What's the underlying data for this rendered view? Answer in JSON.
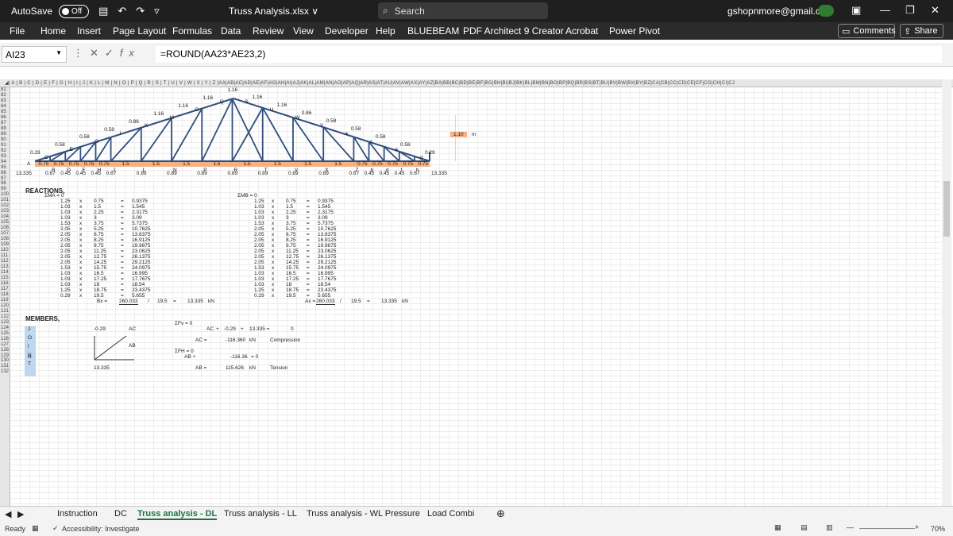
{
  "titlebar": {
    "autosave_label": "AutoSave",
    "autosave_state": "Off",
    "document_title": "Truss Analysis.xlsx ∨",
    "search_placeholder": "Search",
    "account_email": "gshopnmore@gmail.com"
  },
  "menu": {
    "file": "File",
    "home": "Home",
    "insert": "Insert",
    "page_layout": "Page Layout",
    "formulas": "Formulas",
    "data": "Data",
    "review": "Review",
    "view": "View",
    "developer": "Developer",
    "help": "Help",
    "bluebeam": "BLUEBEAM",
    "pdf_architect": "PDF Architect 9 Creator",
    "acrobat": "Acrobat",
    "power_pivot": "Power Pivot",
    "comments": "Comments",
    "share": "Share"
  },
  "formula_bar": {
    "name_box": "AI23",
    "fx": "fx",
    "formula": "=ROUND(AA23*AE23,2)"
  },
  "sheet": {
    "row_start": 81,
    "row_end": 132,
    "reactions_title": "REACTIONS,",
    "members_title": "MEMBERS,",
    "sum_ma": "ΣMA",
    "sum_mb": "ΣMB",
    "sum_fv": "ΣFv",
    "sum_fh": "ΣFH",
    "bx_label": "Bx =",
    "bx_value": "260.033",
    "ax_label": "Ax =",
    "ax_value": "260.033",
    "divide": "/",
    "span": "19.5",
    "equals": "=",
    "reaction_value": "13.335",
    "unit_kn": "kN",
    "unit_m": "m",
    "height_value": "1.10",
    "reactions_left": [
      [
        "1.25",
        "x",
        "0.75",
        "=",
        "0.9375"
      ],
      [
        "1.03",
        "x",
        "1.5",
        "=",
        "1.545"
      ],
      [
        "1.03",
        "x",
        "2.25",
        "=",
        "2.3175"
      ],
      [
        "1.03",
        "x",
        "3",
        "=",
        "3.09"
      ],
      [
        "1.53",
        "x",
        "3.75",
        "=",
        "5.7375"
      ],
      [
        "2.05",
        "x",
        "5.25",
        "=",
        "10.7625"
      ],
      [
        "2.05",
        "x",
        "6.75",
        "=",
        "13.8375"
      ],
      [
        "2.05",
        "x",
        "8.25",
        "=",
        "16.9125"
      ],
      [
        "2.05",
        "x",
        "9.75",
        "=",
        "19.9875"
      ],
      [
        "2.05",
        "x",
        "11.25",
        "=",
        "23.0625"
      ],
      [
        "2.05",
        "x",
        "12.75",
        "=",
        "26.1375"
      ],
      [
        "2.05",
        "x",
        "14.25",
        "=",
        "29.2125"
      ],
      [
        "1.53",
        "x",
        "15.75",
        "=",
        "24.0975"
      ],
      [
        "1.03",
        "x",
        "16.5",
        "=",
        "16.995"
      ],
      [
        "1.03",
        "x",
        "17.25",
        "=",
        "17.7675"
      ],
      [
        "1.03",
        "x",
        "18",
        "=",
        "18.54"
      ],
      [
        "1.25",
        "x",
        "18.75",
        "=",
        "23.4375"
      ],
      [
        "0.29",
        "x",
        "19.5",
        "=",
        "5.655"
      ]
    ],
    "reactions_right": [
      [
        "1.25",
        "x",
        "0.75",
        "=",
        "0.9375"
      ],
      [
        "1.03",
        "x",
        "1.5",
        "=",
        "1.545"
      ],
      [
        "1.03",
        "x",
        "2.25",
        "=",
        "2.3175"
      ],
      [
        "1.03",
        "x",
        "3",
        "=",
        "3.09"
      ],
      [
        "1.53",
        "x",
        "3.75",
        "=",
        "5.7375"
      ],
      [
        "2.05",
        "x",
        "5.25",
        "=",
        "10.7625"
      ],
      [
        "2.05",
        "x",
        "6.75",
        "=",
        "13.8375"
      ],
      [
        "2.05",
        "x",
        "8.25",
        "=",
        "16.9125"
      ],
      [
        "2.05",
        "x",
        "9.75",
        "=",
        "19.9875"
      ],
      [
        "2.05",
        "x",
        "11.25",
        "=",
        "23.0625"
      ],
      [
        "2.05",
        "x",
        "12.75",
        "=",
        "26.1375"
      ],
      [
        "2.05",
        "x",
        "14.25",
        "=",
        "29.2125"
      ],
      [
        "1.53",
        "x",
        "15.75",
        "=",
        "24.0975"
      ],
      [
        "1.03",
        "x",
        "16.5",
        "=",
        "16.995"
      ],
      [
        "1.03",
        "x",
        "17.25",
        "=",
        "17.7675"
      ],
      [
        "1.03",
        "x",
        "18",
        "=",
        "18.54"
      ],
      [
        "1.25",
        "x",
        "18.75",
        "=",
        "23.4375"
      ],
      [
        "0.29",
        "x",
        "19.5",
        "=",
        "5.655"
      ]
    ],
    "truss": {
      "bottom_chord_segments": [
        "0.75",
        "0.75",
        "0.75",
        "0.75",
        "0.75",
        "1.5",
        "1.5",
        "1.5",
        "1.5",
        "1.5",
        "1.5",
        "1.5",
        "1.5",
        "0.75",
        "0.75",
        "0.75",
        "0.75",
        "0.75"
      ],
      "bottom_loads": [
        "13.335",
        "0.67",
        "0.45",
        "0.45",
        "0.45",
        "0.67",
        "0.89",
        "0.89",
        "0.89",
        "0.89",
        "0.89",
        "0.89",
        "0.89",
        "0.67",
        "0.45",
        "0.45",
        "0.45",
        "0.67",
        "13.335"
      ],
      "top_loads": [
        "0.29",
        "0.58",
        "0.58",
        "0.58",
        "0.86",
        "1.16",
        "1.16",
        "1.16",
        "1.16",
        "1.16",
        "1.16",
        "0.86",
        "0.58",
        "0.58",
        "0.58",
        "0.58",
        "0.29"
      ],
      "joint_labels_top": [
        "C",
        "E",
        "G",
        "I",
        "K",
        "M",
        "O",
        "Q",
        "S",
        "U",
        "W",
        "Y",
        "a",
        "c",
        "e",
        "g"
      ],
      "joint_labels_bottom": [
        "A",
        "B",
        "D",
        "F",
        "H",
        "J",
        "L",
        "N",
        "P",
        "R",
        "T",
        "V",
        "X",
        "Z",
        "b",
        "d",
        "f",
        "h"
      ]
    },
    "members": {
      "joint_letters": [
        "J",
        "O",
        "I",
        "N",
        "T"
      ],
      "joint_a": "A",
      "force_ac_label": "AC",
      "force_ab_label": "AB",
      "left_load": "-0.29",
      "left_reaction": "13.335",
      "fv_row_label": "AC",
      "fv_plus": "+",
      "fv_load": "-0.29",
      "fv_reaction": "13.335",
      "fv_result": "0",
      "ac_eq": "AC =",
      "ac_value": "-116.360",
      "compression": "Compression",
      "fh_row_label": "AB +",
      "fh_value": "-116.36",
      "fh_eq": "= 0",
      "ab_eq": "AB =",
      "ab_value": "115.626",
      "tension": "Tension",
      "zero": "0"
    }
  },
  "tabs": [
    "Instruction",
    "DC",
    "Truss analysis - DL",
    "Truss analysis - LL",
    "Truss analysis - WL Pressure",
    "Load Combi"
  ],
  "status": {
    "ready": "Ready",
    "accessibility": "Accessibility: Investigate",
    "zoom": "70%"
  },
  "colors": {
    "titlebar_bg": "#1f1f1f",
    "truss_blue": "#2f4f7f",
    "bottom_band": "#f4b183",
    "active_tab": "#1e7145"
  }
}
